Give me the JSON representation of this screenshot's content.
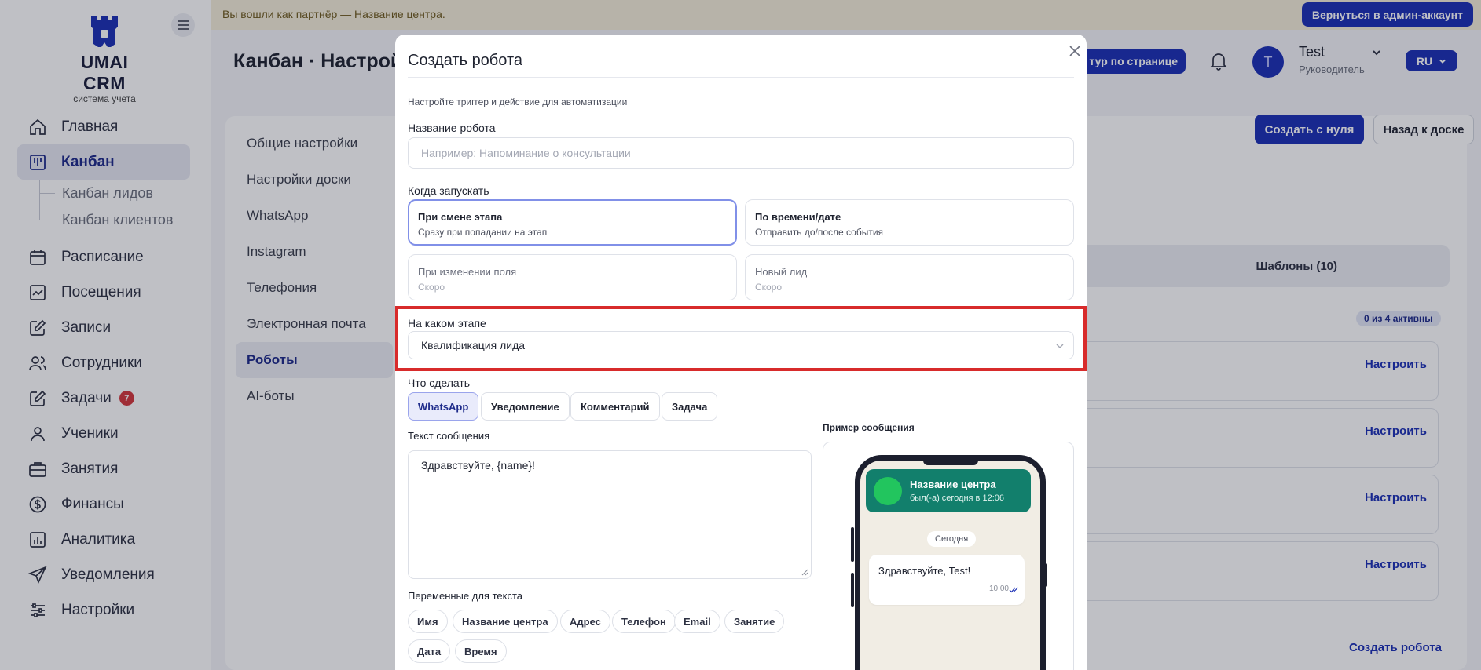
{
  "banner": {
    "text": "Вы вошли как партнёр — Название центра.",
    "back_button": "Вернуться в админ-аккаунт"
  },
  "brand": {
    "name": "UMAI CRM",
    "subtitle": "система учета"
  },
  "sidebar": {
    "items": [
      {
        "label": "Главная",
        "icon": "home-icon"
      },
      {
        "label": "Канбан",
        "icon": "kanban-icon",
        "active": true
      },
      {
        "label": "Расписание",
        "icon": "calendar-icon"
      },
      {
        "label": "Посещения",
        "icon": "chart-check-icon"
      },
      {
        "label": "Записи",
        "icon": "edit-icon"
      },
      {
        "label": "Сотрудники",
        "icon": "users-icon"
      },
      {
        "label": "Задачи",
        "icon": "tasks-icon",
        "badge": "7"
      },
      {
        "label": "Ученики",
        "icon": "user-icon"
      },
      {
        "label": "Занятия",
        "icon": "briefcase-icon"
      },
      {
        "label": "Финансы",
        "icon": "dollar-icon"
      },
      {
        "label": "Аналитика",
        "icon": "bar-chart-icon"
      },
      {
        "label": "Уведомления",
        "icon": "send-icon"
      },
      {
        "label": "Настройки",
        "icon": "sliders-icon"
      }
    ],
    "sub_items": [
      "Канбан лидов",
      "Канбан клиентов"
    ]
  },
  "header": {
    "page_title": "Канбан · Настрой",
    "tour_button": "тур по странице",
    "user_initial": "T",
    "user_name": "Test",
    "user_role": "Руководитель",
    "language": "RU"
  },
  "settings_menu": {
    "items": [
      "Общие настройки",
      "Настройки доски",
      "WhatsApp",
      "Instagram",
      "Телефония",
      "Электронная почта",
      "Роботы",
      "AI-боты"
    ],
    "active": "Роботы"
  },
  "robots_panel": {
    "create_from_scratch": "Создать с нуля",
    "back_to_board": "Назад к доске",
    "templates_tab": "Шаблоны (10)",
    "active_count": "0 из 4 активны",
    "configure_label": "Настроить",
    "create_robot": "Создать робота"
  },
  "modal": {
    "title": "Создать робота",
    "hint": "Настройте триггер и действие для автоматизации",
    "name_label": "Название робота",
    "name_placeholder": "Например: Напоминание о консультации",
    "name_value": "",
    "when_label": "Когда запускать",
    "triggers": [
      {
        "title": "При смене этапа",
        "desc": "Сразу при попадании на этап",
        "selected": true
      },
      {
        "title": "По времени/дате",
        "desc": "Отправить до/после события"
      },
      {
        "title": "При изменении поля",
        "desc": "Скоро",
        "disabled": true
      },
      {
        "title": "Новый лид",
        "desc": "Скоро",
        "disabled": true
      }
    ],
    "stage_label": "На каком этапе",
    "stage_value": "Квалификация лида",
    "action_label": "Что сделать",
    "actions": [
      "WhatsApp",
      "Уведомление",
      "Комментарий",
      "Задача"
    ],
    "active_action": "WhatsApp",
    "message_label": "Текст сообщения",
    "message_value": "Здравствуйте, {name}!",
    "variables_label": "Переменные для текста",
    "variables": [
      "Имя",
      "Название центра",
      "Адрес",
      "Телефон",
      "Email",
      "Занятие",
      "Дата",
      "Время"
    ],
    "preview": {
      "label": "Пример сообщения",
      "contact_name": "Название центра",
      "contact_status": "был(-а) сегодня в 12:06",
      "day": "Сегодня",
      "message": "Здравствуйте, Test!",
      "time": "10:00"
    }
  },
  "colors": {
    "primary": "#1b2fb5",
    "highlight_border": "#d82b2b",
    "whatsapp_header": "#127f6c"
  }
}
